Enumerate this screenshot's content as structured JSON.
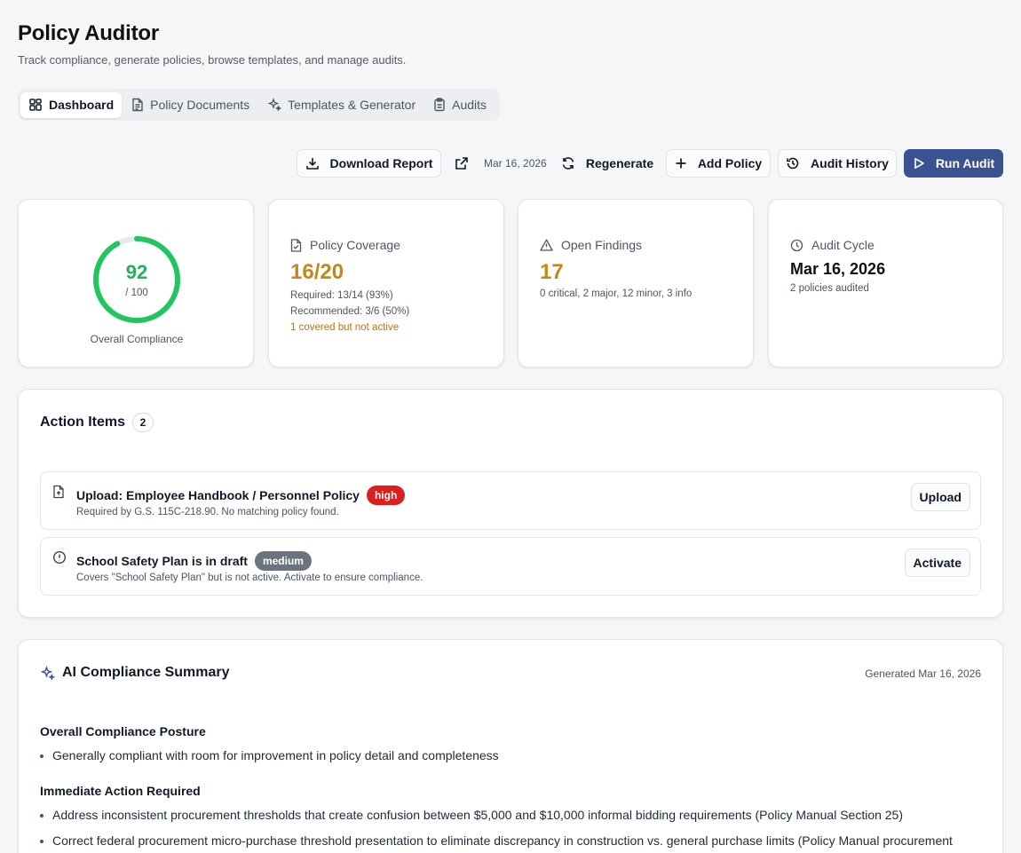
{
  "header": {
    "title": "Policy Auditor",
    "subtitle": "Track compliance, generate policies, browse templates, and manage audits."
  },
  "tabs": [
    {
      "label": "Dashboard",
      "icon": "layout-grid-icon",
      "active": true
    },
    {
      "label": "Policy Documents",
      "icon": "file-text-icon",
      "active": false
    },
    {
      "label": "Templates & Generator",
      "icon": "sparkles-icon",
      "active": false
    },
    {
      "label": "Audits",
      "icon": "clipboard-icon",
      "active": false
    }
  ],
  "toolbar": {
    "download_label": "Download Report",
    "report_date": "Mar 16, 2026",
    "regenerate_label": "Regenerate",
    "add_policy_label": "Add Policy",
    "audit_history_label": "Audit History",
    "run_audit_label": "Run Audit"
  },
  "stats": {
    "compliance": {
      "score": "92",
      "max": "/ 100",
      "label": "Overall Compliance",
      "score_value": 92,
      "color": "#22c55e"
    },
    "coverage": {
      "label": "Policy Coverage",
      "value": "16/20",
      "required": "Required: 13/14 (93%)",
      "recommended": "Recommended: 3/6 (50%)",
      "warning": "1 covered but not active"
    },
    "findings": {
      "label": "Open Findings",
      "value": "17",
      "breakdown": "0 critical, 2 major, 12 minor, 3 info"
    },
    "cycle": {
      "label": "Audit Cycle",
      "date": "Mar 16, 2026",
      "detail": "2 policies audited"
    }
  },
  "action_items": {
    "title": "Action Items",
    "count": "2",
    "items": [
      {
        "icon": "file-upload-icon",
        "title": "Upload: Employee Handbook / Personnel Policy",
        "badge": "high",
        "description": "Required by G.S. 115C-218.90. No matching policy found.",
        "button": "Upload"
      },
      {
        "icon": "alert-circle-icon",
        "title": "School Safety Plan is in draft",
        "badge": "medium",
        "description": "Covers \"School Safety Plan\" but is not active. Activate to ensure compliance.",
        "button": "Activate"
      }
    ]
  },
  "ai_summary": {
    "title": "AI Compliance Summary",
    "generated": "Generated Mar 16, 2026",
    "sections": [
      {
        "heading": "Overall Compliance Posture",
        "bullets": [
          "Generally compliant with room for improvement in policy detail and completeness"
        ]
      },
      {
        "heading": "Immediate Action Required",
        "bullets": [
          "Address inconsistent procurement thresholds that create confusion between $5,000 and $10,000 informal bidding requirements (Policy Manual Section 25)",
          "Correct federal procurement micro-purchase threshold presentation to eliminate discrepancy in construction vs. general purchase limits (Policy Manual procurement"
        ]
      }
    ]
  },
  "colors": {
    "accent": "#3b5291",
    "success": "#22c55e",
    "warning": "#c08a16",
    "danger": "#dc2626"
  }
}
